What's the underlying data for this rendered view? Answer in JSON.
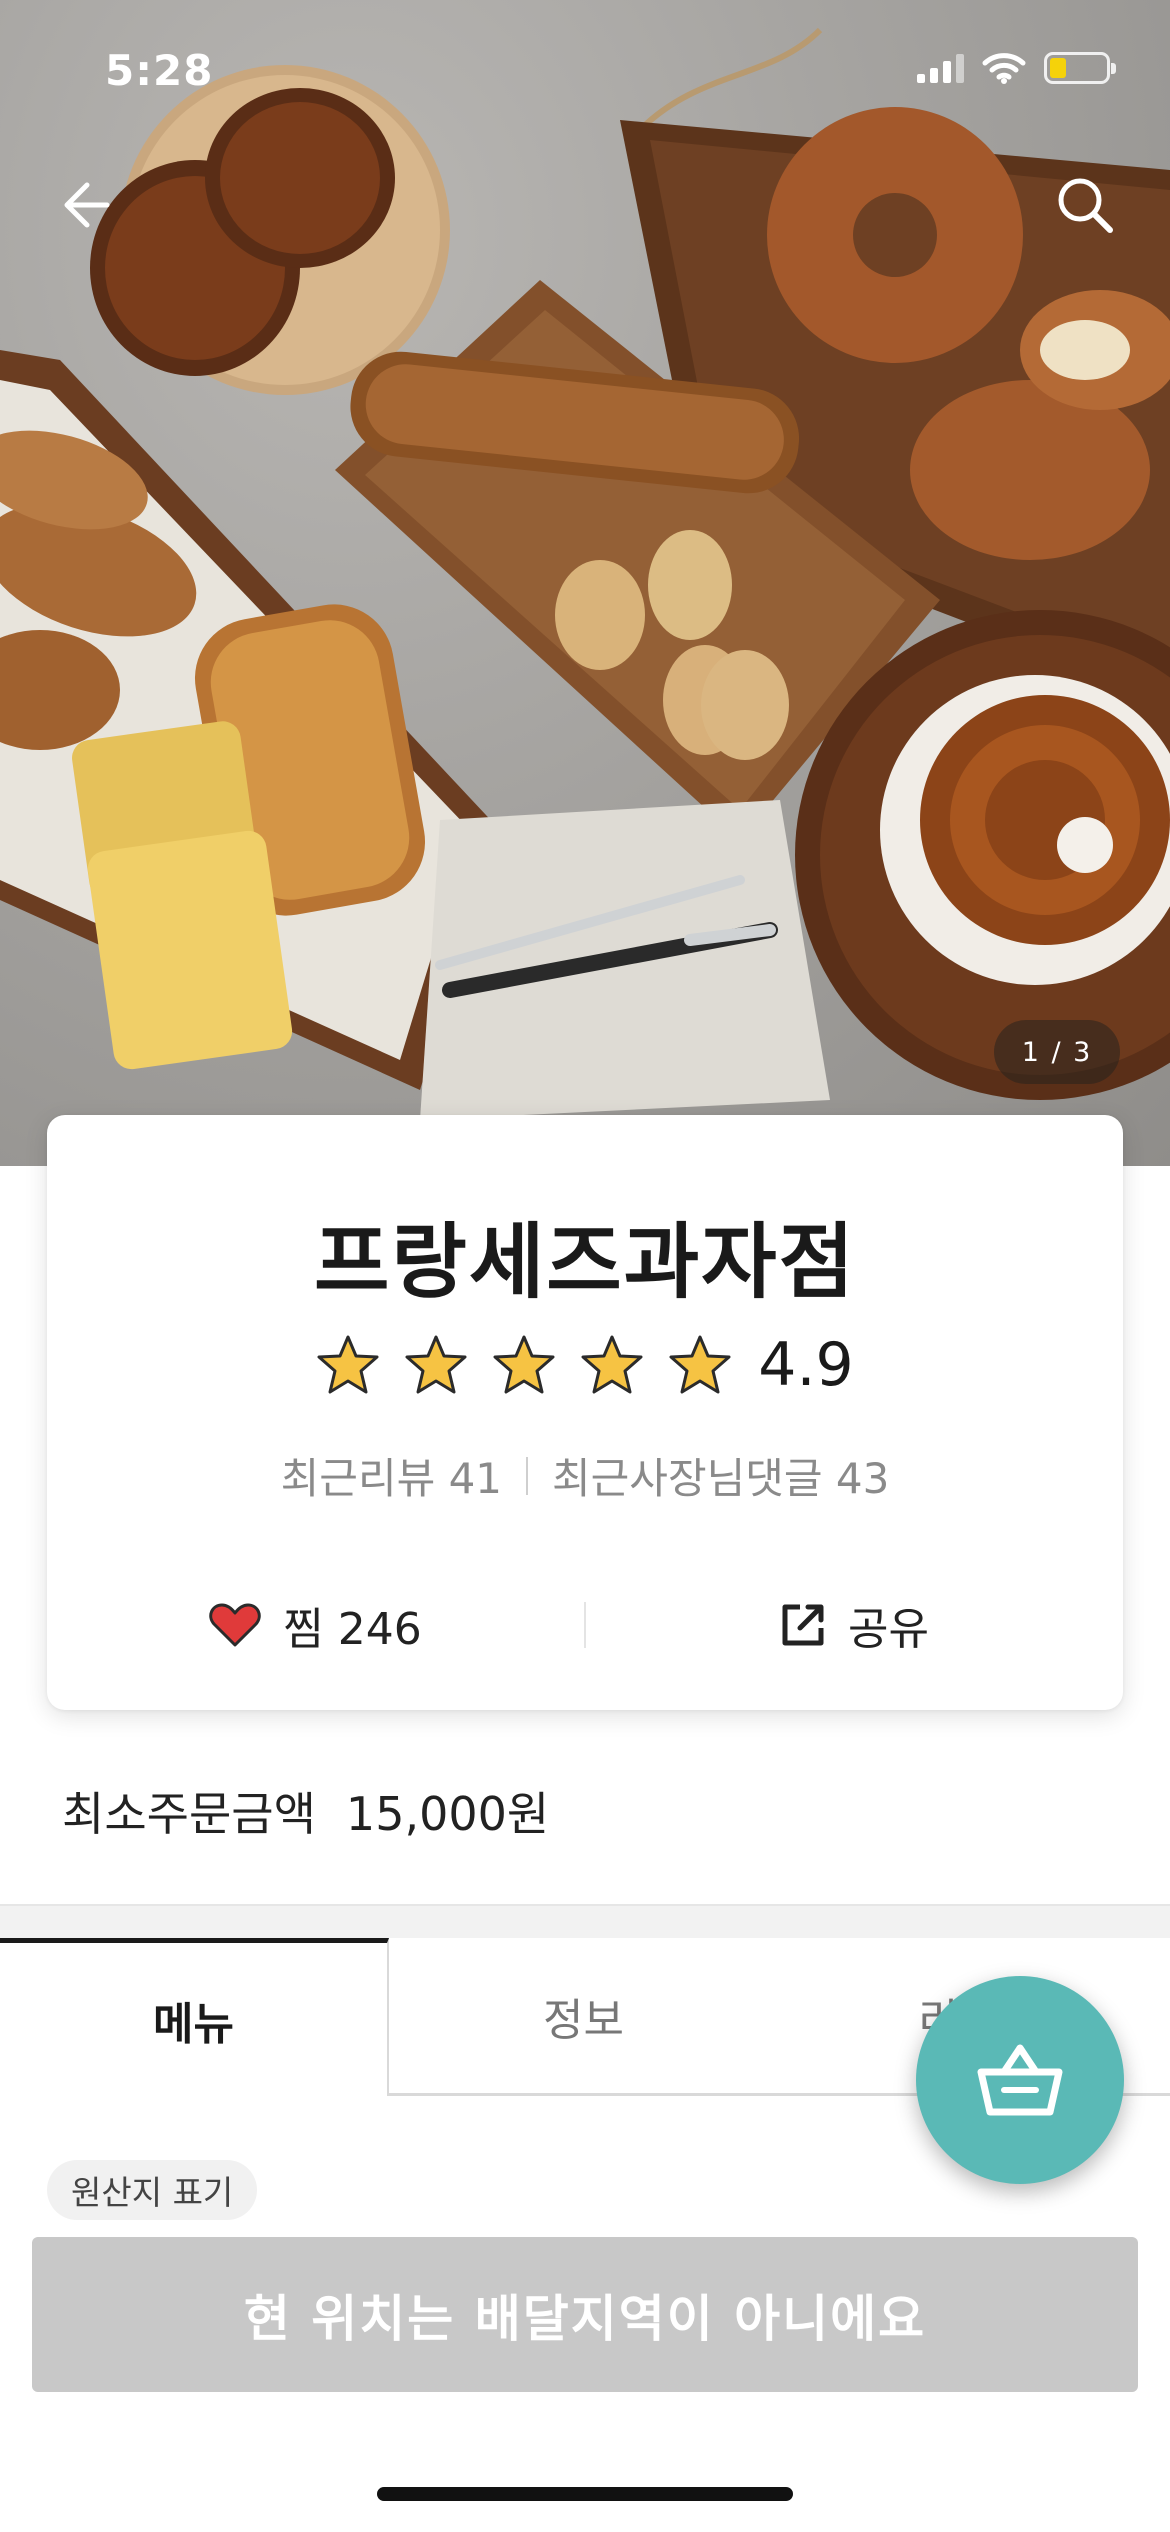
{
  "status_bar": {
    "time": "5:28"
  },
  "hero": {
    "page_counter": "1 / 3"
  },
  "store": {
    "name": "프랑세즈과자점",
    "rating": "4.9",
    "star_count": 5,
    "recent_reviews": "최근리뷰 41",
    "recent_owner_comments": "최근사장님댓글 43",
    "like_label": "찜 246",
    "share_label": "공유"
  },
  "min_order": {
    "label": "최소주문금액",
    "value": "15,000원"
  },
  "tabs": [
    {
      "label": "메뉴"
    },
    {
      "label": "정보"
    },
    {
      "label": "리"
    }
  ],
  "origin_chip": "원산지 표기",
  "delivery_banner": "현 위치는 배달지역이 아니에요",
  "colors": {
    "accent_teal": "#5ab9b6",
    "heart_red": "#e03a3a",
    "star_yellow": "#f6c343",
    "banner_gray": "#c8c8c8"
  },
  "icons": [
    "back-arrow-icon",
    "search-icon",
    "star-icon",
    "heart-icon",
    "share-icon",
    "cart-basket-icon"
  ]
}
